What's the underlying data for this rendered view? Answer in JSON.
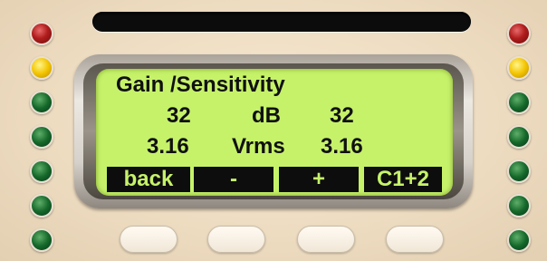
{
  "display": {
    "title": "Gain /Sensitivity",
    "gain": {
      "left": "32",
      "unit": "dB",
      "right": "32"
    },
    "sensitivity": {
      "left": "3.16",
      "unit": "Vrms",
      "right": "3.16"
    },
    "softkeys": [
      "back",
      "-",
      "+",
      "C1+2"
    ]
  },
  "colors": {
    "lcd_background": "#c6f26a",
    "lcd_text": "#101010",
    "led_red": "#b11d1d",
    "led_amber": "#f3c400",
    "led_green": "#15692a"
  },
  "left_leds": [
    "red",
    "amber",
    "green",
    "green",
    "green",
    "green",
    "green"
  ],
  "right_leds": [
    "red",
    "amber",
    "green",
    "green",
    "green",
    "green",
    "green"
  ]
}
